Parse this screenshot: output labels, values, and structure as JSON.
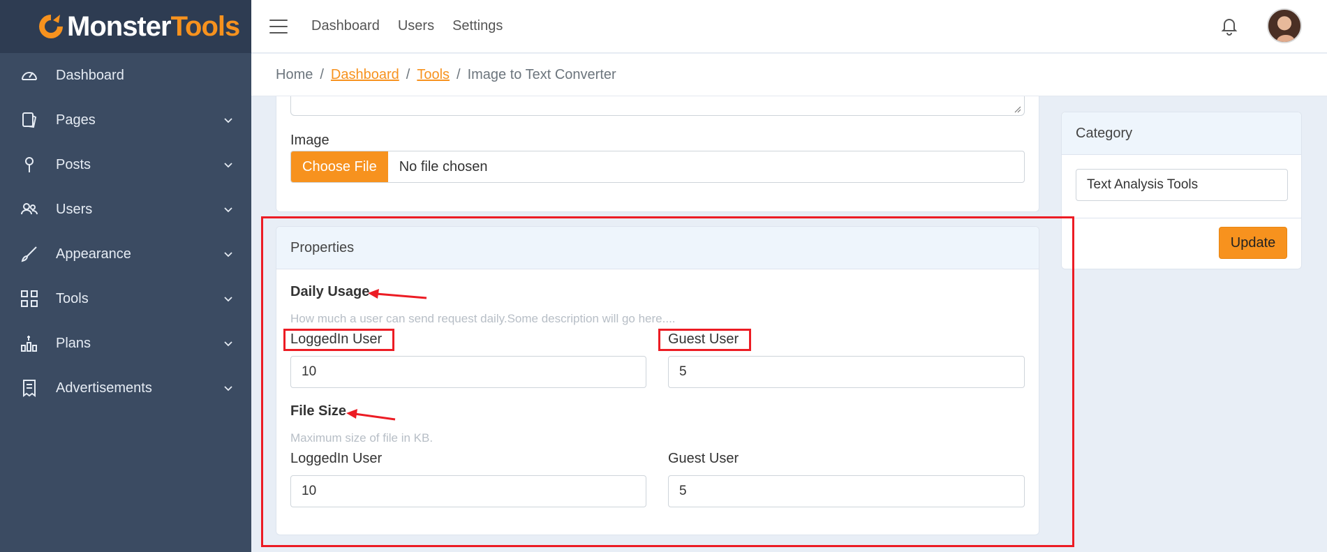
{
  "brand": {
    "word1": "Monster",
    "word2": "Tools",
    "icon": "monster-logo-icon",
    "accent": "#f7921e",
    "sidebar_bg": "#3b4b62"
  },
  "sidebar": {
    "items": [
      {
        "label": "Dashboard",
        "icon": "speedometer-icon",
        "has_chevron": false
      },
      {
        "label": "Pages",
        "icon": "pages-icon",
        "has_chevron": true
      },
      {
        "label": "Posts",
        "icon": "pin-icon",
        "has_chevron": true
      },
      {
        "label": "Users",
        "icon": "users-icon",
        "has_chevron": true
      },
      {
        "label": "Appearance",
        "icon": "brush-icon",
        "has_chevron": true
      },
      {
        "label": "Tools",
        "icon": "grid-icon",
        "has_chevron": true
      },
      {
        "label": "Plans",
        "icon": "plans-chart-icon",
        "has_chevron": true
      },
      {
        "label": "Advertisements",
        "icon": "receipt-icon",
        "has_chevron": true
      }
    ]
  },
  "topbar": {
    "links": [
      "Dashboard",
      "Users",
      "Settings"
    ],
    "bell_icon": "bell-icon",
    "avatar": "user-avatar"
  },
  "breadcrumb": {
    "home": "Home",
    "dashboard": "Dashboard",
    "tools": "Tools",
    "current": "Image to Text Converter",
    "separator": "/"
  },
  "image_card": {
    "label": "Image",
    "choose_file": "Choose File",
    "file_status": "No file chosen"
  },
  "properties": {
    "header": "Properties",
    "daily_usage": {
      "title": "Daily Usage",
      "description": "How much a user can send request daily.Some description will go here....",
      "logged_label": "LoggedIn User",
      "logged_value": "10",
      "guest_label": "Guest User",
      "guest_value": "5"
    },
    "file_size": {
      "title": "File Size",
      "description": "Maximum size of file in KB.",
      "logged_label": "LoggedIn User",
      "logged_value": "10",
      "guest_label": "Guest User",
      "guest_value": "5"
    }
  },
  "category": {
    "header": "Category",
    "value": "Text Analysis Tools",
    "update_button": "Update"
  },
  "annotation_color": "#ec1c24"
}
